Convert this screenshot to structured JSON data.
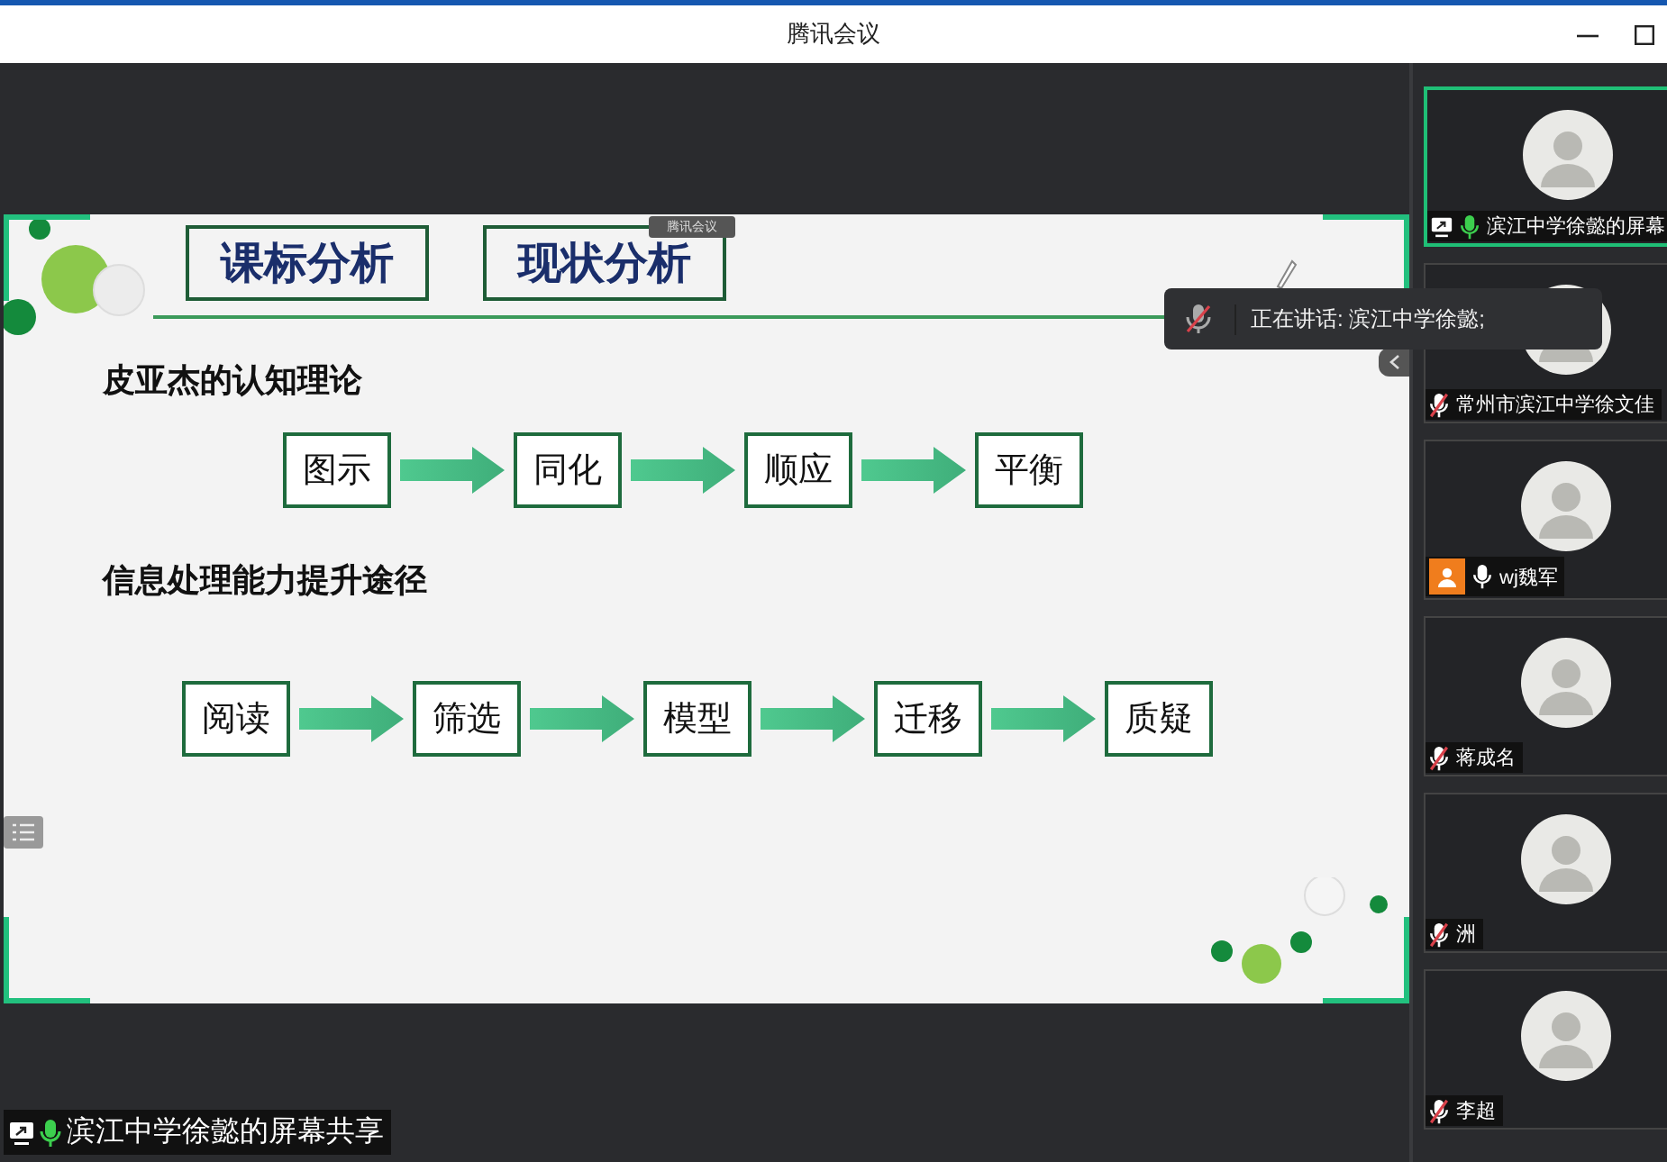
{
  "window": {
    "title": "腾讯会议"
  },
  "slide": {
    "badge": "腾讯会议",
    "header_tabs": [
      "课标分析",
      "现状分析"
    ],
    "sections": [
      {
        "heading": "皮亚杰的认知理论",
        "steps": [
          "图示",
          "同化",
          "顺应",
          "平衡"
        ]
      },
      {
        "heading": "信息处理能力提升途径",
        "steps": [
          "阅读",
          "筛选",
          "模型",
          "迁移",
          "质疑"
        ]
      }
    ]
  },
  "speaking_toast": {
    "text": "正在讲话: 滨江中学徐懿;"
  },
  "share_label": {
    "text": "滨江中学徐懿的屏幕共享",
    "muted": false,
    "speaking": true
  },
  "participants": [
    {
      "name": "滨江中学徐懿的屏幕",
      "selected": true,
      "muted": false,
      "speaking": true,
      "kind": "sharer"
    },
    {
      "name": "常州市滨江中学徐文佳",
      "selected": false,
      "muted": true,
      "speaking": false,
      "kind": "member"
    },
    {
      "name": "wj魏军",
      "selected": false,
      "muted": false,
      "speaking": false,
      "kind": "no_video"
    },
    {
      "name": "蒋成名",
      "selected": false,
      "muted": true,
      "speaking": false,
      "kind": "member"
    },
    {
      "name": "洲",
      "selected": false,
      "muted": true,
      "speaking": false,
      "kind": "member"
    },
    {
      "name": "李超",
      "selected": false,
      "muted": true,
      "speaking": false,
      "kind": "member"
    }
  ]
}
